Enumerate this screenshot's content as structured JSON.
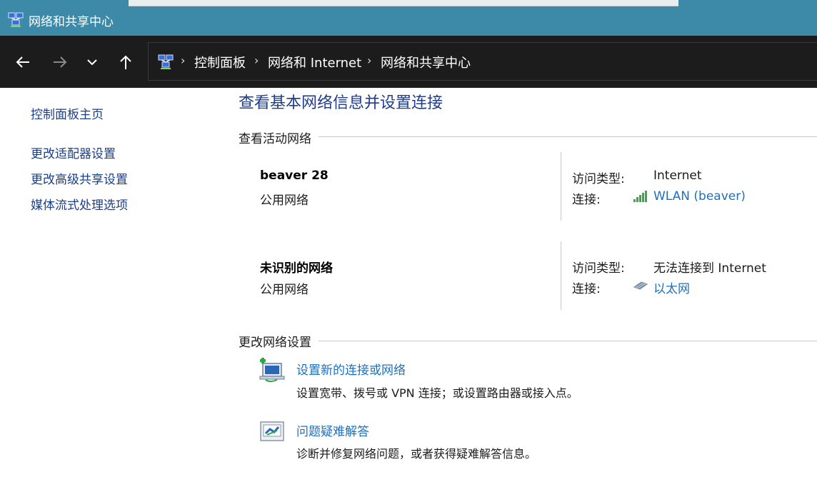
{
  "window": {
    "title": "网络和共享中心",
    "app_icon": "network-center-icon"
  },
  "toolbar": {
    "back_icon": "back-arrow-icon",
    "forward_icon": "forward-arrow-icon",
    "recent_icon": "chevron-down-icon",
    "up_icon": "up-arrow-icon",
    "breadcrumb": [
      "控制面板",
      "网络和 Internet",
      "网络和共享中心"
    ],
    "separator": "›"
  },
  "sidebar": {
    "items": [
      {
        "label": "控制面板主页"
      },
      {
        "label": "更改适配器设置"
      },
      {
        "label": "更改高级共享设置"
      },
      {
        "label": "媒体流式处理选项"
      }
    ]
  },
  "main": {
    "heading": "查看基本网络信息并设置连接",
    "active_networks_title": "查看活动网络",
    "networks": [
      {
        "name": "beaver 28",
        "type": "公用网络",
        "access_label": "访问类型:",
        "access_value": "Internet",
        "connection_label": "连接:",
        "connection_value": "WLAN (beaver)",
        "connection_icon": "wifi-signal-icon"
      },
      {
        "name": "未识别的网络",
        "type": "公用网络",
        "access_label": "访问类型:",
        "access_value": "无法连接到 Internet",
        "connection_label": "连接:",
        "connection_value": "以太网",
        "connection_icon": "ethernet-icon"
      }
    ],
    "change_settings_title": "更改网络设置",
    "tasks": [
      {
        "link": "设置新的连接或网络",
        "description": "设置宽带、拨号或 VPN 连接；或设置路由器或接入点。",
        "icon": "new-connection-icon"
      },
      {
        "link": "问题疑难解答",
        "description": "诊断并修复网络问题，或者获得疑难解答信息。",
        "icon": "troubleshoot-icon"
      }
    ]
  },
  "colors": {
    "titlebar": "#3d8aa8",
    "toolbar": "#1c1c1c",
    "link": "#1e6fc0",
    "heading": "#1f3d8c",
    "nav_link": "#1a3f8a"
  }
}
